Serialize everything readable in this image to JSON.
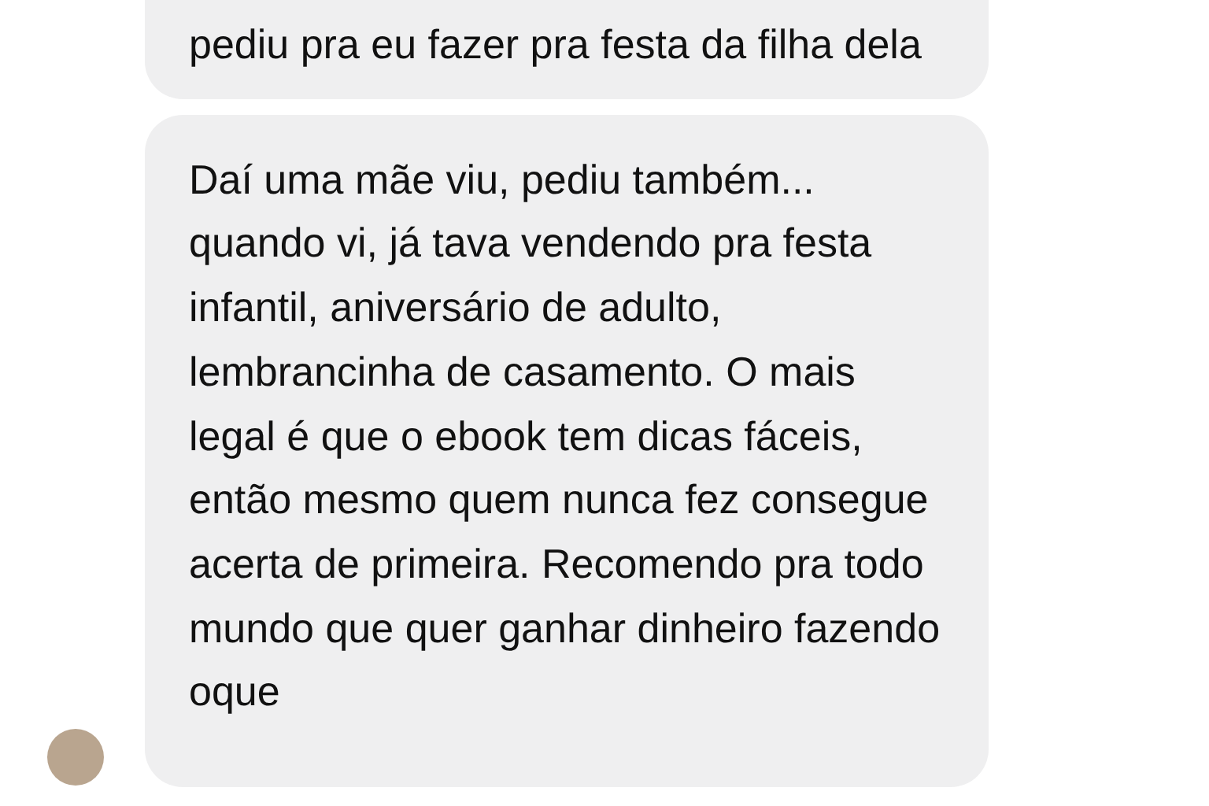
{
  "messages": [
    {
      "text": "pediu pra eu fazer pra festa da filha dela",
      "show_avatar": false,
      "cut_top": true
    },
    {
      "text": "Daí uma mãe viu, pediu também... quando vi, já tava vendendo pra festa infantil, aniversário de adulto, lembrancinha de casamento. O mais legal é que o ebook tem dicas fáceis, então mesmo quem nunca fez consegue acerta de primeira. Recomendo pra todo mundo que quer ganhar dinheiro fazendo oque",
      "show_avatar": true,
      "cut_top": false
    }
  ]
}
